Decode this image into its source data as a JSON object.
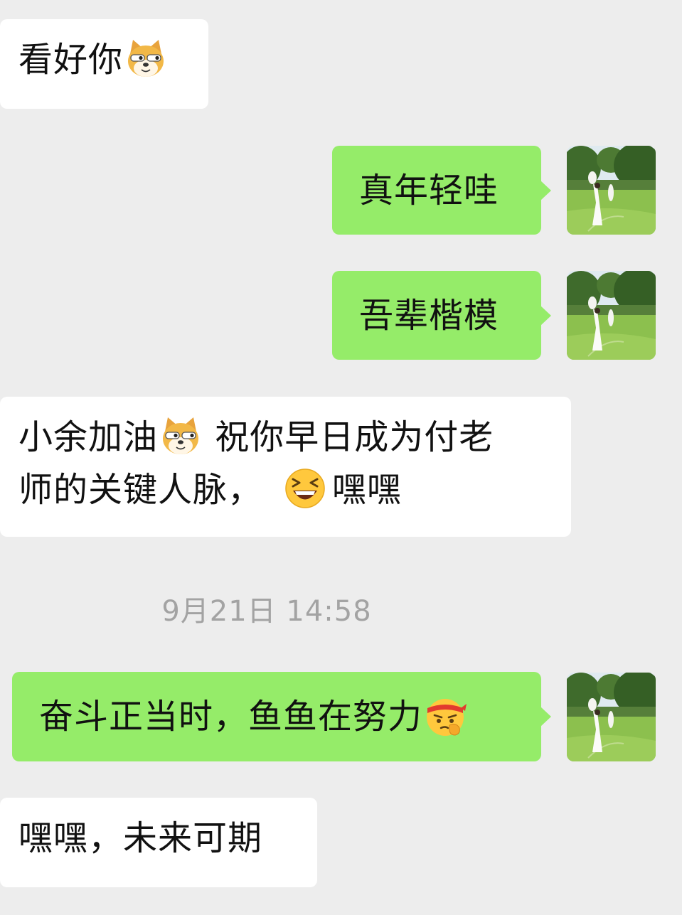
{
  "messages": [
    {
      "direction": "incoming",
      "text": "看好你",
      "emoji": "doge-face-icon"
    },
    {
      "direction": "outgoing",
      "text": "真年轻哇"
    },
    {
      "direction": "outgoing",
      "text": "吾辈楷模"
    },
    {
      "direction": "incoming",
      "line1_a": "小余加油",
      "emoji1": "doge-face-icon",
      "line1_b": " 祝你早日成为付老",
      "line2_a": "师的关键人脉，",
      "emoji2": "laughing-face-icon",
      "line2_b": "嘿嘿"
    },
    {
      "direction": "outgoing",
      "text": "奋斗正当时，鱼鱼在努力",
      "emoji": "determined-face-icon"
    },
    {
      "direction": "incoming",
      "text": "嘿嘿，未来可期"
    }
  ],
  "timestamp": "9月21日 14:58",
  "avatar": "avatar-photo-icon",
  "colors": {
    "background": "#ededed",
    "incoming_bubble": "#ffffff",
    "outgoing_bubble": "#95ec69",
    "timestamp_text": "#a3a3a3"
  }
}
